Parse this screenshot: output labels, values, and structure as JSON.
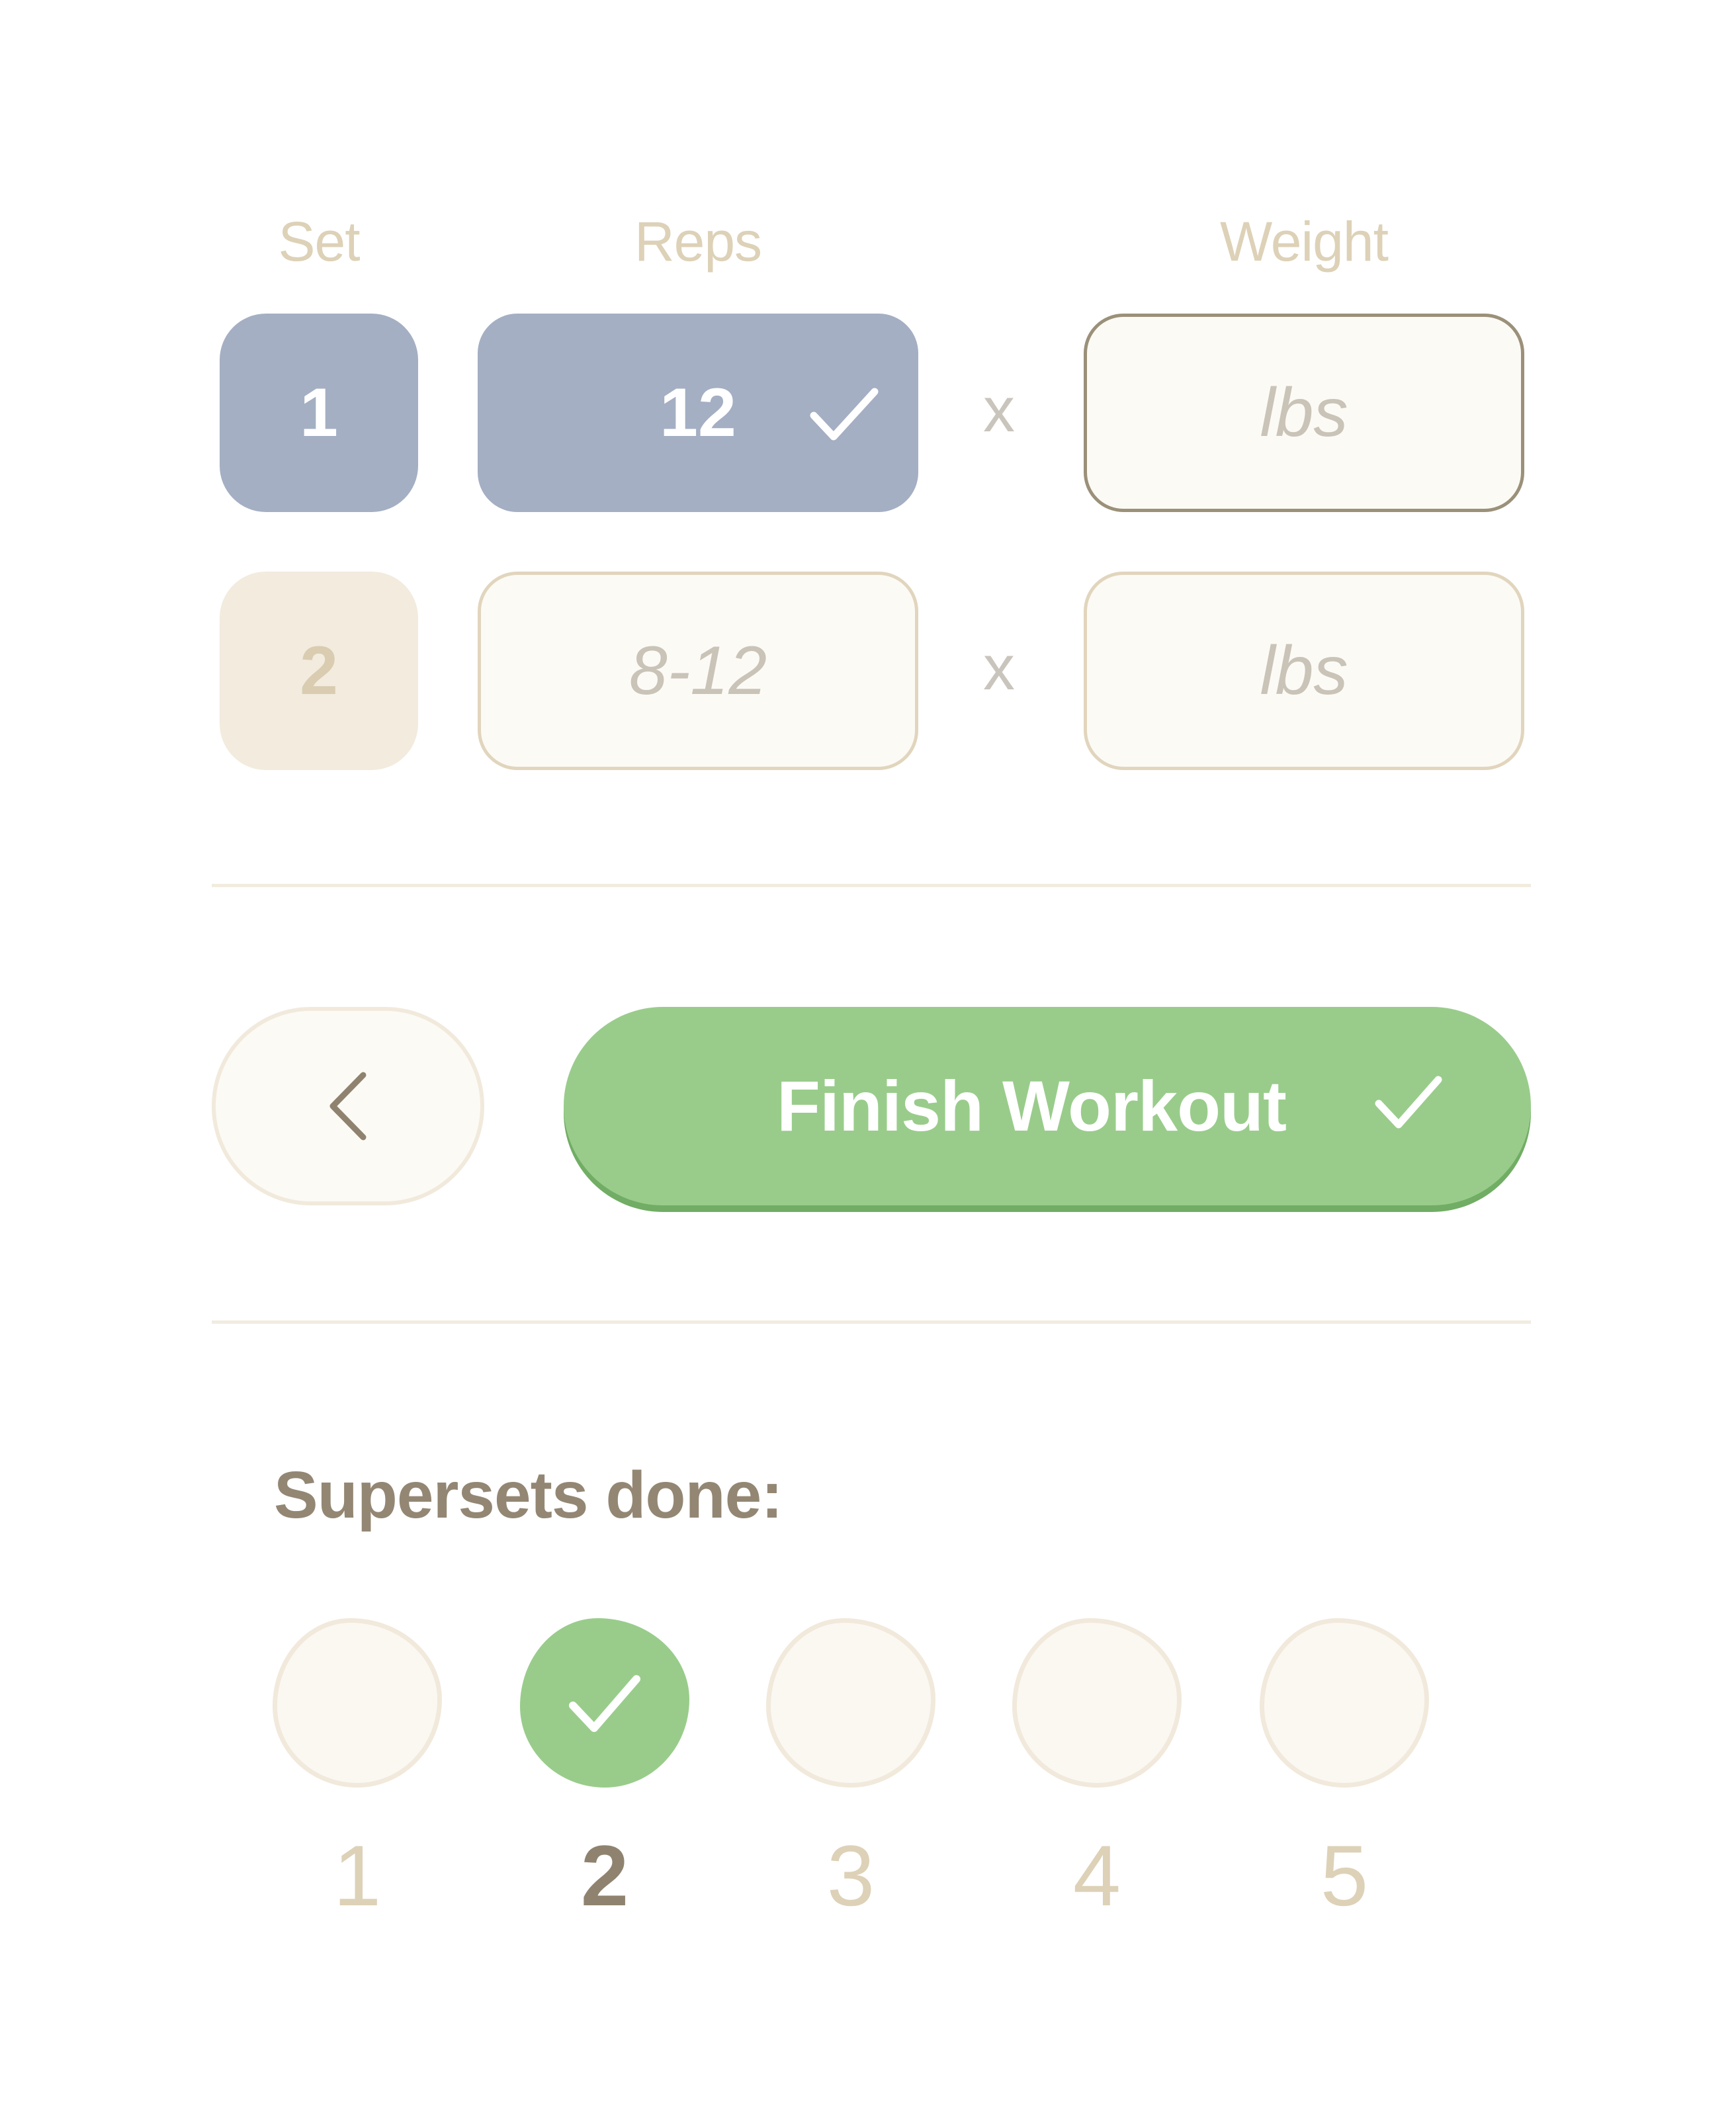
{
  "headers": {
    "set": "Set",
    "reps": "Reps",
    "weight": "Weight"
  },
  "sets": [
    {
      "number": "1",
      "reps_value": "12",
      "reps_completed": true,
      "weight_placeholder": "lbs",
      "separator": "x"
    },
    {
      "number": "2",
      "reps_placeholder": "8-12",
      "weight_placeholder": "lbs",
      "separator": "x"
    }
  ],
  "actions": {
    "back_icon": "chevron-left-icon",
    "finish_label": "Finish Workout",
    "finish_icon": "check-icon"
  },
  "supersets": {
    "title": "Supersets done:",
    "items": [
      {
        "label": "1",
        "done": false
      },
      {
        "label": "2",
        "done": true
      },
      {
        "label": "3",
        "done": false
      },
      {
        "label": "4",
        "done": false
      },
      {
        "label": "5",
        "done": false
      }
    ],
    "current": "2"
  },
  "colors": {
    "completed_blue": "#a4afc3",
    "accent_green": "#99cc8b",
    "beige_text": "#ddd1b7",
    "brown_text": "#938774",
    "field_bg": "#fcfaf5"
  }
}
